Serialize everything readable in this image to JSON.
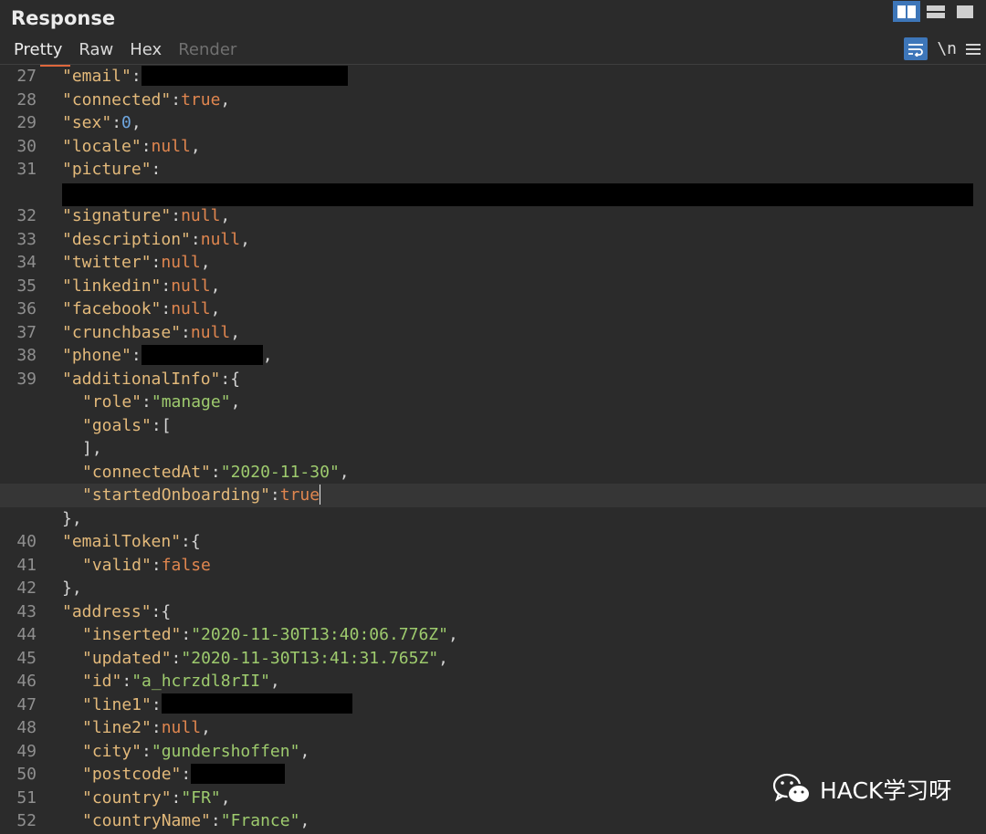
{
  "header": {
    "title": "Response",
    "tabs": [
      "Pretty",
      "Raw",
      "Hex",
      "Render"
    ],
    "newline_label": "\\n"
  },
  "lines": [
    {
      "n": "27",
      "i": 0,
      "t": [
        [
          "k",
          "\"email\""
        ],
        [
          "p",
          ":"
        ],
        [
          "r",
          226
        ]
      ]
    },
    {
      "n": "28",
      "i": 0,
      "t": [
        [
          "k",
          "\"connected\""
        ],
        [
          "p",
          ":"
        ],
        [
          "b",
          "true"
        ],
        [
          "p",
          ","
        ]
      ]
    },
    {
      "n": "29",
      "i": 0,
      "t": [
        [
          "k",
          "\"sex\""
        ],
        [
          "p",
          ":"
        ],
        [
          "n",
          "0"
        ],
        [
          "p",
          ","
        ]
      ]
    },
    {
      "n": "30",
      "i": 0,
      "t": [
        [
          "k",
          "\"locale\""
        ],
        [
          "p",
          ":"
        ],
        [
          "b",
          "null"
        ],
        [
          "p",
          ","
        ]
      ]
    },
    {
      "n": "31",
      "i": 0,
      "tall": true,
      "t": [
        [
          "k",
          "\"picture\""
        ],
        [
          "p",
          ":"
        ]
      ]
    },
    {
      "n": "32",
      "i": 0,
      "t": [
        [
          "k",
          "\"signature\""
        ],
        [
          "p",
          ":"
        ],
        [
          "b",
          "null"
        ],
        [
          "p",
          ","
        ]
      ]
    },
    {
      "n": "33",
      "i": 0,
      "t": [
        [
          "k",
          "\"description\""
        ],
        [
          "p",
          ":"
        ],
        [
          "b",
          "null"
        ],
        [
          "p",
          ","
        ]
      ]
    },
    {
      "n": "34",
      "i": 0,
      "t": [
        [
          "k",
          "\"twitter\""
        ],
        [
          "p",
          ":"
        ],
        [
          "b",
          "null"
        ],
        [
          "p",
          ","
        ]
      ]
    },
    {
      "n": "35",
      "i": 0,
      "t": [
        [
          "k",
          "\"linkedin\""
        ],
        [
          "p",
          ":"
        ],
        [
          "b",
          "null"
        ],
        [
          "p",
          ","
        ]
      ]
    },
    {
      "n": "36",
      "i": 0,
      "t": [
        [
          "k",
          "\"facebook\""
        ],
        [
          "p",
          ":"
        ],
        [
          "b",
          "null"
        ],
        [
          "p",
          ","
        ]
      ]
    },
    {
      "n": "37",
      "i": 0,
      "t": [
        [
          "k",
          "\"crunchbase\""
        ],
        [
          "p",
          ":"
        ],
        [
          "b",
          "null"
        ],
        [
          "p",
          ","
        ]
      ]
    },
    {
      "n": "38",
      "i": 0,
      "t": [
        [
          "k",
          "\"phone\""
        ],
        [
          "p",
          ":"
        ],
        [
          "r",
          133
        ],
        [
          "p",
          ","
        ]
      ]
    },
    {
      "n": "39",
      "i": 0,
      "t": [
        [
          "k",
          "\"additionalInfo\""
        ],
        [
          "p",
          ":{"
        ]
      ]
    },
    {
      "n": "",
      "i": 1,
      "t": [
        [
          "k",
          "\"role\""
        ],
        [
          "p",
          ":"
        ],
        [
          "s",
          "\"manage\""
        ],
        [
          "p",
          ","
        ]
      ]
    },
    {
      "n": "",
      "i": 1,
      "t": [
        [
          "k",
          "\"goals\""
        ],
        [
          "p",
          ":["
        ]
      ]
    },
    {
      "n": "",
      "i": 1,
      "t": [
        [
          "p",
          "],"
        ]
      ]
    },
    {
      "n": "",
      "i": 1,
      "t": [
        [
          "k",
          "\"connectedAt\""
        ],
        [
          "p",
          ":"
        ],
        [
          "s",
          "\"2020-11-30\""
        ],
        [
          "p",
          ","
        ]
      ]
    },
    {
      "n": "",
      "i": 1,
      "cursor": true,
      "t": [
        [
          "k",
          "\"startedOnboarding\""
        ],
        [
          "p",
          ":"
        ],
        [
          "b",
          "true"
        ],
        [
          "c",
          ""
        ]
      ]
    },
    {
      "n": "",
      "i": 0,
      "t": [
        [
          "p",
          "},"
        ]
      ]
    },
    {
      "n": "40",
      "i": 0,
      "t": [
        [
          "k",
          "\"emailToken\""
        ],
        [
          "p",
          ":{"
        ]
      ]
    },
    {
      "n": "41",
      "i": 1,
      "t": [
        [
          "k",
          "\"valid\""
        ],
        [
          "p",
          ":"
        ],
        [
          "b",
          "false"
        ]
      ]
    },
    {
      "n": "42",
      "i": 0,
      "t": [
        [
          "p",
          "},"
        ]
      ]
    },
    {
      "n": "43",
      "i": 0,
      "t": [
        [
          "k",
          "\"address\""
        ],
        [
          "p",
          ":{"
        ]
      ]
    },
    {
      "n": "44",
      "i": 1,
      "t": [
        [
          "k",
          "\"inserted\""
        ],
        [
          "p",
          ":"
        ],
        [
          "s",
          "\"2020-11-30T13:40:06.776Z\""
        ],
        [
          "p",
          ","
        ]
      ]
    },
    {
      "n": "45",
      "i": 1,
      "t": [
        [
          "k",
          "\"updated\""
        ],
        [
          "p",
          ":"
        ],
        [
          "s",
          "\"2020-11-30T13:41:31.765Z\""
        ],
        [
          "p",
          ","
        ]
      ]
    },
    {
      "n": "46",
      "i": 1,
      "t": [
        [
          "k",
          "\"id\""
        ],
        [
          "p",
          ":"
        ],
        [
          "s",
          "\"a_hcrzdl8rII\""
        ],
        [
          "p",
          ","
        ]
      ]
    },
    {
      "n": "47",
      "i": 1,
      "t": [
        [
          "k",
          "\"line1\""
        ],
        [
          "p",
          ":"
        ],
        [
          "r",
          209
        ]
      ]
    },
    {
      "n": "48",
      "i": 1,
      "t": [
        [
          "k",
          "\"line2\""
        ],
        [
          "p",
          ":"
        ],
        [
          "b",
          "null"
        ],
        [
          "p",
          ","
        ]
      ]
    },
    {
      "n": "49",
      "i": 1,
      "t": [
        [
          "k",
          "\"city\""
        ],
        [
          "p",
          ":"
        ],
        [
          "s",
          "\"gundershoffen\""
        ],
        [
          "p",
          ","
        ]
      ]
    },
    {
      "n": "50",
      "i": 1,
      "t": [
        [
          "k",
          "\"postcode\""
        ],
        [
          "p",
          ":"
        ],
        [
          "r",
          103
        ]
      ]
    },
    {
      "n": "51",
      "i": 1,
      "t": [
        [
          "k",
          "\"country\""
        ],
        [
          "p",
          ":"
        ],
        [
          "s",
          "\"FR\""
        ],
        [
          "p",
          ","
        ]
      ]
    },
    {
      "n": "52",
      "i": 1,
      "t": [
        [
          "k",
          "\"countryName\""
        ],
        [
          "p",
          ":"
        ],
        [
          "s",
          "\"France\""
        ],
        [
          "p",
          ","
        ]
      ]
    }
  ],
  "watermark": {
    "text": "HACK学习呀",
    "icon": "wechat-icon"
  },
  "colors": {
    "accent": "#3d76b9",
    "tab_underline": "#e0683c",
    "key": "#e3b97a",
    "string": "#9ecb6e",
    "keyword": "#e0864f",
    "number": "#6fa7e0"
  }
}
